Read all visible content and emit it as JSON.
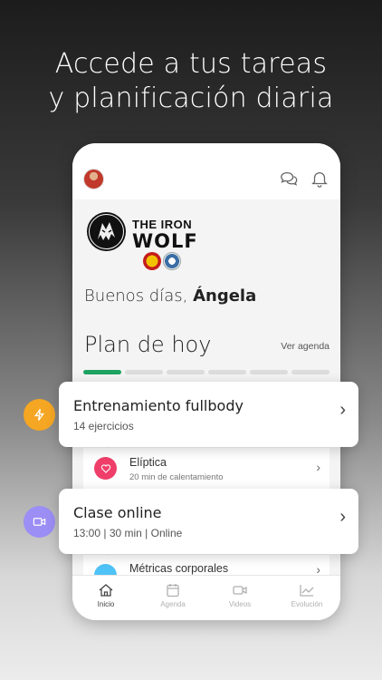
{
  "headline": {
    "line1": "Accede a tus tareas",
    "line2": "y planificación diaria"
  },
  "header": {
    "icons": [
      "avatar",
      "chat-icon",
      "bell-icon"
    ]
  },
  "brand": {
    "line1": "THE IRON",
    "line2": "WOLF"
  },
  "greeting": {
    "prefix": "Buenos días,",
    "name": "Ángela"
  },
  "plan": {
    "title": "Plan de hoy",
    "link": "Ver agenda",
    "progress_done": 1,
    "progress_total": 6
  },
  "cards": [
    {
      "title": "Entrenamiento fullbody",
      "subtitle": "14 ejercicios",
      "icon": "lightning-icon",
      "color": "#f5a623"
    },
    {
      "title": "Clase online",
      "subtitle": "13:00 | 30 min | Online",
      "icon": "video-icon",
      "color": "#9b8ef5"
    }
  ],
  "list": [
    {
      "title": "Elíptica",
      "subtitle": "20 min de calentamiento",
      "icon": "heart-icon",
      "color": "#ef3e6a"
    },
    {
      "title": "Métricas corporales",
      "subtitle": "",
      "icon": "metrics-icon",
      "color": "#4fc3f7"
    }
  ],
  "tabs": [
    {
      "label": "Inicio",
      "icon": "home-icon",
      "active": true
    },
    {
      "label": "Agenda",
      "icon": "calendar-icon",
      "active": false
    },
    {
      "label": "Videos",
      "icon": "camera-icon",
      "active": false
    },
    {
      "label": "Evolución",
      "icon": "chart-icon",
      "active": false
    }
  ]
}
